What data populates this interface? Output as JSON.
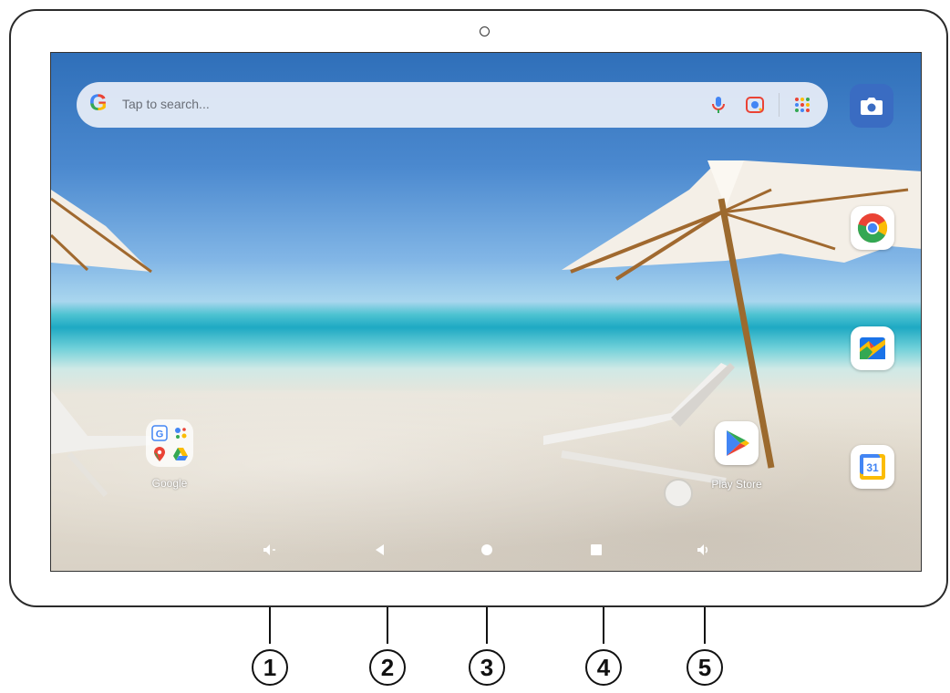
{
  "search": {
    "placeholder": "Tap to search..."
  },
  "apps": {
    "folder_label": "Google",
    "playstore_label": "Play Store"
  },
  "icons": {
    "search_bar": [
      "google-g-icon",
      "microphone-icon",
      "google-lens-icon",
      "app-grid-icon"
    ],
    "right_column": [
      "chrome-icon",
      "photos-icon",
      "calendar-icon"
    ],
    "nav": [
      "volume-down-icon",
      "back-icon",
      "home-icon",
      "recents-icon",
      "volume-up-icon"
    ]
  },
  "calendar_day": "31",
  "callouts": [
    "1",
    "2",
    "3",
    "4",
    "5"
  ],
  "colors": {
    "camera_app": "#3a6cc2",
    "google_blue": "#4285f4",
    "google_red": "#ea4335",
    "google_yellow": "#fbbc05",
    "google_green": "#34a853"
  }
}
